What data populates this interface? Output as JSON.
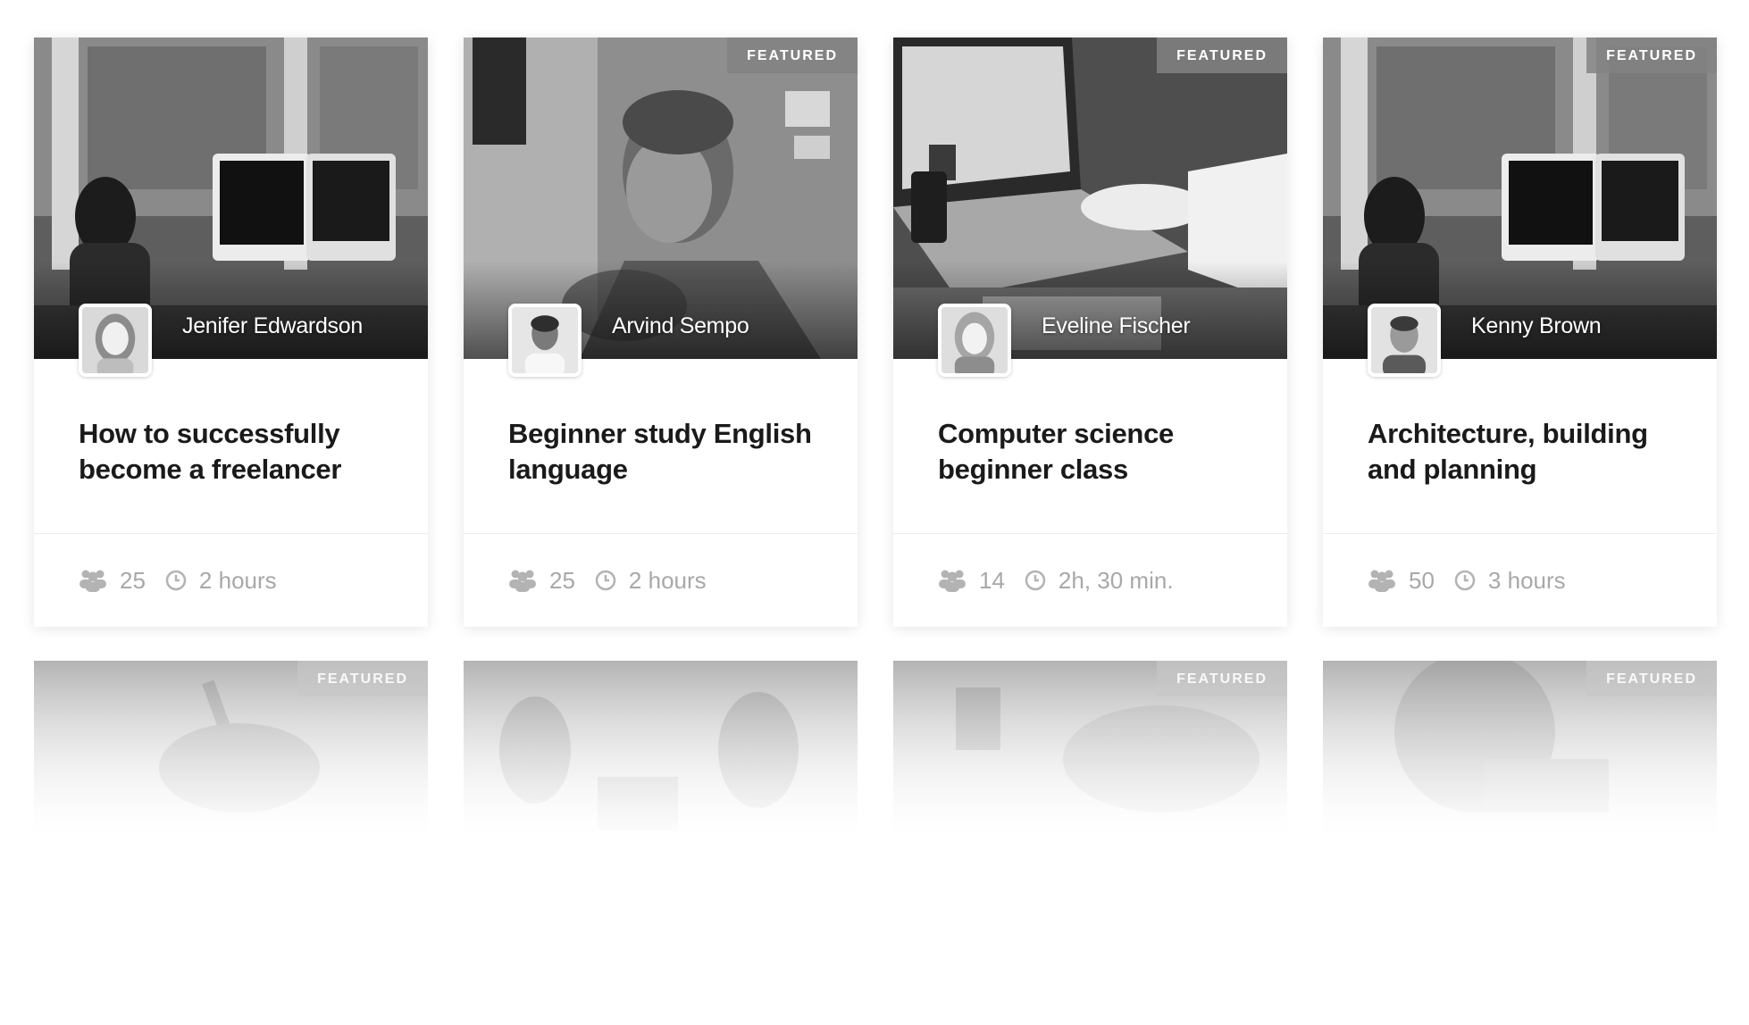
{
  "courses": [
    {
      "featured": false,
      "author": "Jenifer Edwardson",
      "title": "How to successfully become a freelancer",
      "students": "25",
      "duration": "2 hours",
      "scene": "office-woman"
    },
    {
      "featured": true,
      "badge": "FEATURED",
      "author": "Arvind Sempo",
      "title": "Beginner study English language",
      "students": "25",
      "duration": "2 hours",
      "scene": "bearded-man"
    },
    {
      "featured": true,
      "badge": "FEATURED",
      "author": "Eveline Fischer",
      "title": "Computer science beginner class",
      "students": "14",
      "duration": "2h, 30 min.",
      "scene": "laptop-typing"
    },
    {
      "featured": true,
      "badge": "FEATURED",
      "author": "Kenny Brown",
      "title": "Architecture, building and planning",
      "students": "50",
      "duration": "3 hours",
      "scene": "office-woman"
    }
  ],
  "faded_row": [
    {
      "featured": true,
      "badge": "FEATURED",
      "scene": "writing-hand"
    },
    {
      "featured": false,
      "scene": "two-people"
    },
    {
      "featured": true,
      "badge": "FEATURED",
      "scene": "desk-cup"
    },
    {
      "featured": true,
      "badge": "FEATURED",
      "scene": "woman-hair"
    }
  ],
  "icons": {
    "students": "users-icon",
    "duration": "clock-icon"
  }
}
